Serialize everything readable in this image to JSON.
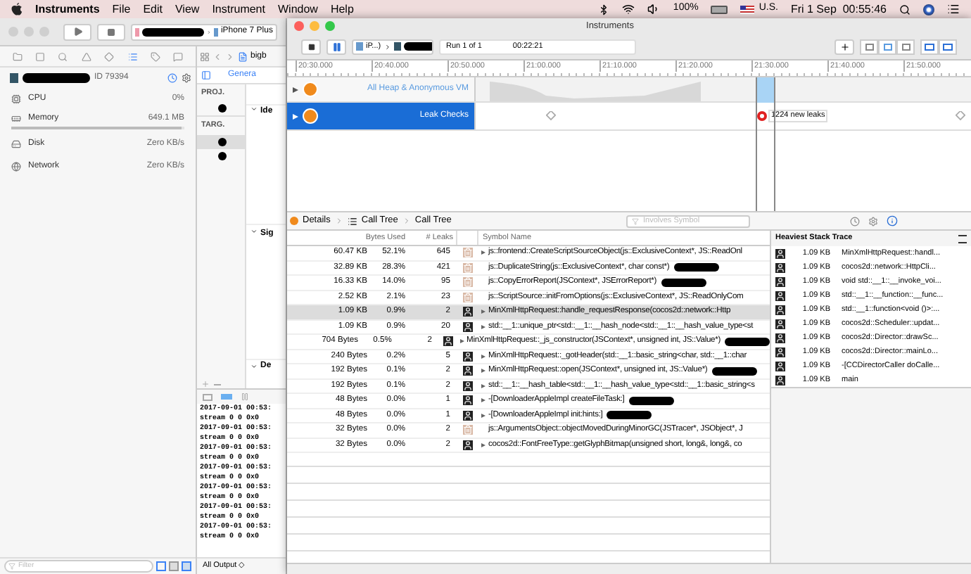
{
  "menu_bar": {
    "app_name": "Instruments",
    "menus": [
      "File",
      "Edit",
      "View",
      "Instrument",
      "Window",
      "Help"
    ],
    "battery": "100%",
    "input_source": "U.S.",
    "clock": "Fri 1 Sep  00:55:46"
  },
  "xcode": {
    "toolbar": {
      "scheme_redacted": true,
      "device": "iPhone 7 Plus"
    },
    "debug_navigator": {
      "process_redacted": true,
      "process_id": "ID 79394",
      "gauges": [
        {
          "kind": "cpu",
          "name": "CPU",
          "value": "0%"
        },
        {
          "kind": "memory",
          "name": "Memory",
          "value": "649.1 MB",
          "level": 0.98
        },
        {
          "kind": "disk",
          "name": "Disk",
          "value": "Zero KB/s"
        },
        {
          "kind": "network",
          "name": "Network",
          "value": "Zero KB/s"
        }
      ]
    },
    "editor": {
      "file_tab": "bigb",
      "section_tab": "Genera",
      "project_header": "PROJ.",
      "targets_header": "TARG.",
      "targets": [
        {
          "selected": true
        },
        {
          "selected": false
        }
      ],
      "sections": [
        "Ide",
        "Sig",
        "De"
      ]
    },
    "console": {
      "lines": [
        "2017-09-01 00:53:",
        "stream 0 0 0x0",
        "2017-09-01 00:53:",
        "stream 0 0 0x0",
        "2017-09-01 00:53:",
        "stream 0 0 0x0",
        "2017-09-01 00:53:",
        "stream 0 0 0x0",
        "2017-09-01 00:53:",
        "stream 0 0 0x0",
        "2017-09-01 00:53:",
        "stream 0 0 0x0",
        "2017-09-01 00:53:",
        "stream 0 0 0x0"
      ],
      "output_filter": "All Output ◇"
    },
    "filter": {
      "placeholder": "Filter"
    }
  },
  "instruments": {
    "title": "Instruments",
    "target": "iP...)",
    "target_redacted": true,
    "run": "Run 1 of 1",
    "elapsed": "00:22:21",
    "ruler_ticks": [
      "20:30.000",
      "20:40.000",
      "20:50.000",
      "21:00.000",
      "21:10.000",
      "21:20.000",
      "21:30.000",
      "21:40.000",
      "21:50.000"
    ],
    "tracks": [
      {
        "kind": "heap",
        "name": "All Heap & Anonymous VM",
        "selected": false
      },
      {
        "kind": "leaks",
        "name": "Leak Checks",
        "selected": true
      }
    ],
    "leak_flag": "1224 new leaks",
    "breadcrumbs": [
      "Details",
      "Call Tree",
      "Call Tree"
    ],
    "search": {
      "placeholder": "Involves Symbol"
    },
    "columns": [
      "Bytes Used",
      "# Leaks",
      "Symbol Name"
    ],
    "rows": [
      {
        "bytes": "60.47 KB",
        "percent": "52.1%",
        "leaks": "645",
        "kind": "system",
        "expandable": true,
        "redacted": false,
        "selected": false,
        "symbol": "js::frontend::CreateScriptSourceObject(js::ExclusiveContext*, JS::ReadOnl"
      },
      {
        "bytes": "32.89 KB",
        "percent": "28.3%",
        "leaks": "421",
        "kind": "system",
        "expandable": false,
        "redacted": true,
        "selected": false,
        "symbol": "js::DuplicateString(js::ExclusiveContext*, char const*)"
      },
      {
        "bytes": "16.33 KB",
        "percent": "14.0%",
        "leaks": "95",
        "kind": "system",
        "expandable": false,
        "redacted": true,
        "selected": false,
        "symbol": "js::CopyErrorReport(JSContext*, JSErrorReport*)"
      },
      {
        "bytes": "2.52 KB",
        "percent": "2.1%",
        "leaks": "23",
        "kind": "system",
        "expandable": false,
        "redacted": false,
        "selected": false,
        "symbol": "js::ScriptSource::initFromOptions(js::ExclusiveContext*, JS::ReadOnlyCom"
      },
      {
        "bytes": "1.09 KB",
        "percent": "0.9%",
        "leaks": "2",
        "kind": "user",
        "expandable": true,
        "redacted": false,
        "selected": true,
        "symbol": "MinXmlHttpRequest::handle_requestResponse(cocos2d::network::Http"
      },
      {
        "bytes": "1.09 KB",
        "percent": "0.9%",
        "leaks": "20",
        "kind": "user",
        "expandable": true,
        "redacted": false,
        "selected": false,
        "symbol": "std::__1::unique_ptr<std::__1::__hash_node<std::__1::__hash_value_type<st"
      },
      {
        "bytes": "704 Bytes",
        "percent": "0.5%",
        "leaks": "2",
        "kind": "user",
        "expandable": true,
        "redacted": true,
        "selected": false,
        "symbol": "MinXmlHttpRequest::_js_constructor(JSContext*, unsigned int, JS::Value*)"
      },
      {
        "bytes": "240 Bytes",
        "percent": "0.2%",
        "leaks": "5",
        "kind": "user",
        "expandable": true,
        "redacted": false,
        "selected": false,
        "symbol": "MinXmlHttpRequest::_gotHeader(std::__1::basic_string<char, std::__1::char"
      },
      {
        "bytes": "192 Bytes",
        "percent": "0.1%",
        "leaks": "2",
        "kind": "user",
        "expandable": true,
        "redacted": true,
        "selected": false,
        "symbol": "MinXmlHttpRequest::open(JSContext*, unsigned int, JS::Value*)"
      },
      {
        "bytes": "192 Bytes",
        "percent": "0.1%",
        "leaks": "2",
        "kind": "user",
        "expandable": true,
        "redacted": false,
        "selected": false,
        "symbol": "std::__1::__hash_table<std::__1::__hash_value_type<std::__1::basic_string<s"
      },
      {
        "bytes": "48 Bytes",
        "percent": "0.0%",
        "leaks": "1",
        "kind": "user",
        "expandable": true,
        "redacted": true,
        "selected": false,
        "symbol": "-[DownloaderAppleImpl createFileTask:]"
      },
      {
        "bytes": "48 Bytes",
        "percent": "0.0%",
        "leaks": "1",
        "kind": "user",
        "expandable": true,
        "redacted": true,
        "selected": false,
        "symbol": "-[DownloaderAppleImpl init:hints:]"
      },
      {
        "bytes": "32 Bytes",
        "percent": "0.0%",
        "leaks": "2",
        "kind": "system",
        "expandable": false,
        "redacted": false,
        "selected": false,
        "symbol": "js::ArgumentsObject::objectMovedDuringMinorGC(JSTracer*, JSObject*, J"
      },
      {
        "bytes": "32 Bytes",
        "percent": "0.0%",
        "leaks": "2",
        "kind": "user",
        "expandable": true,
        "redacted": false,
        "selected": false,
        "symbol": "cocos2d::FontFreeType::getGlyphBitmap(unsigned short, long&, long&, co"
      }
    ],
    "inspector": {
      "title": "Heaviest Stack Trace",
      "frames": [
        {
          "size": "1.09 KB",
          "symbol": "MinXmlHttpRequest::handl..."
        },
        {
          "size": "1.09 KB",
          "symbol": "cocos2d::network::HttpCli..."
        },
        {
          "size": "1.09 KB",
          "symbol": "void std::__1::__invoke_voi..."
        },
        {
          "size": "1.09 KB",
          "symbol": "std::__1::__function::__func..."
        },
        {
          "size": "1.09 KB",
          "symbol": "std::__1::function<void ()>:..."
        },
        {
          "size": "1.09 KB",
          "symbol": "cocos2d::Scheduler::updat..."
        },
        {
          "size": "1.09 KB",
          "symbol": "cocos2d::Director::drawSc..."
        },
        {
          "size": "1.09 KB",
          "symbol": "cocos2d::Director::mainLo..."
        },
        {
          "size": "1.09 KB",
          "symbol": "-[CCDirectorCaller doCalle..."
        },
        {
          "size": "1.09 KB",
          "symbol": "main"
        }
      ]
    }
  }
}
